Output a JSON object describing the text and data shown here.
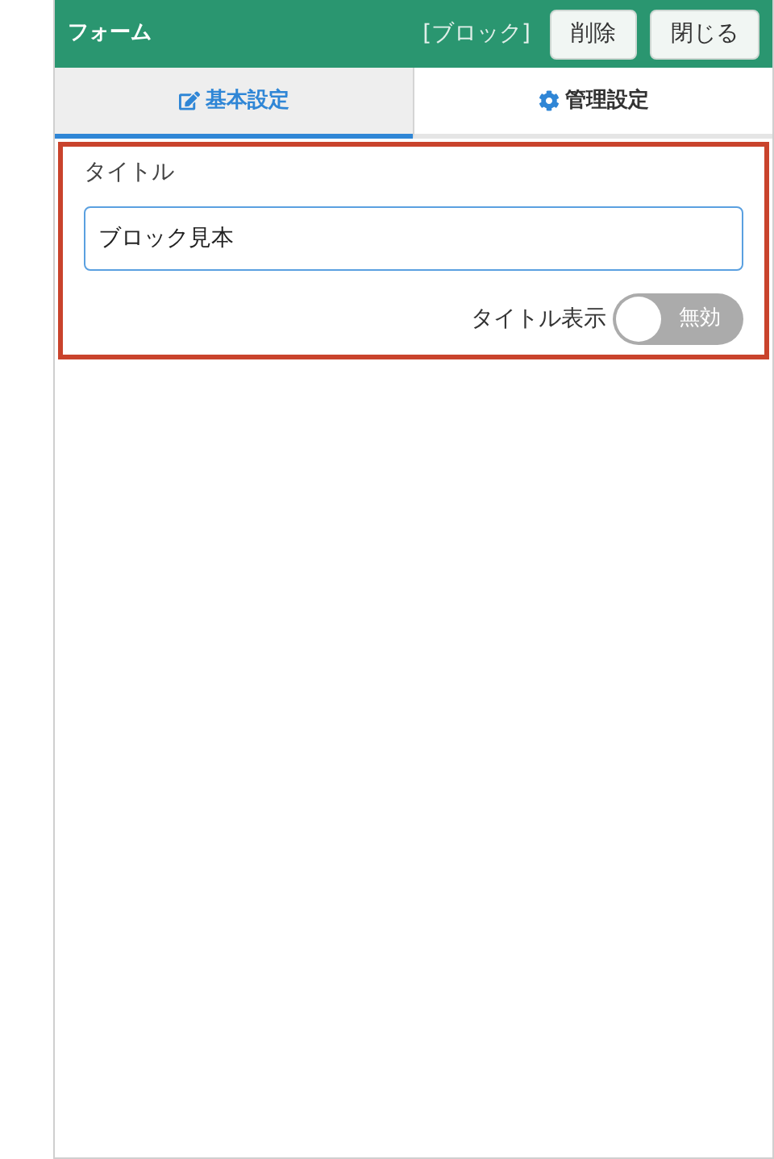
{
  "header": {
    "title": "フォーム",
    "block_label": "[ブロック]",
    "buttons": [
      "削除",
      "閉じる"
    ]
  },
  "tabs": [
    {
      "label": "基本設定",
      "selected": true
    },
    {
      "label": "管理設定",
      "selected": false
    }
  ],
  "form": {
    "highlighted": true,
    "field_label": "タイトル",
    "value": "ブロック見本",
    "toggle": {
      "label": "タイトル表示",
      "on": false,
      "text": "無効"
    }
  }
}
